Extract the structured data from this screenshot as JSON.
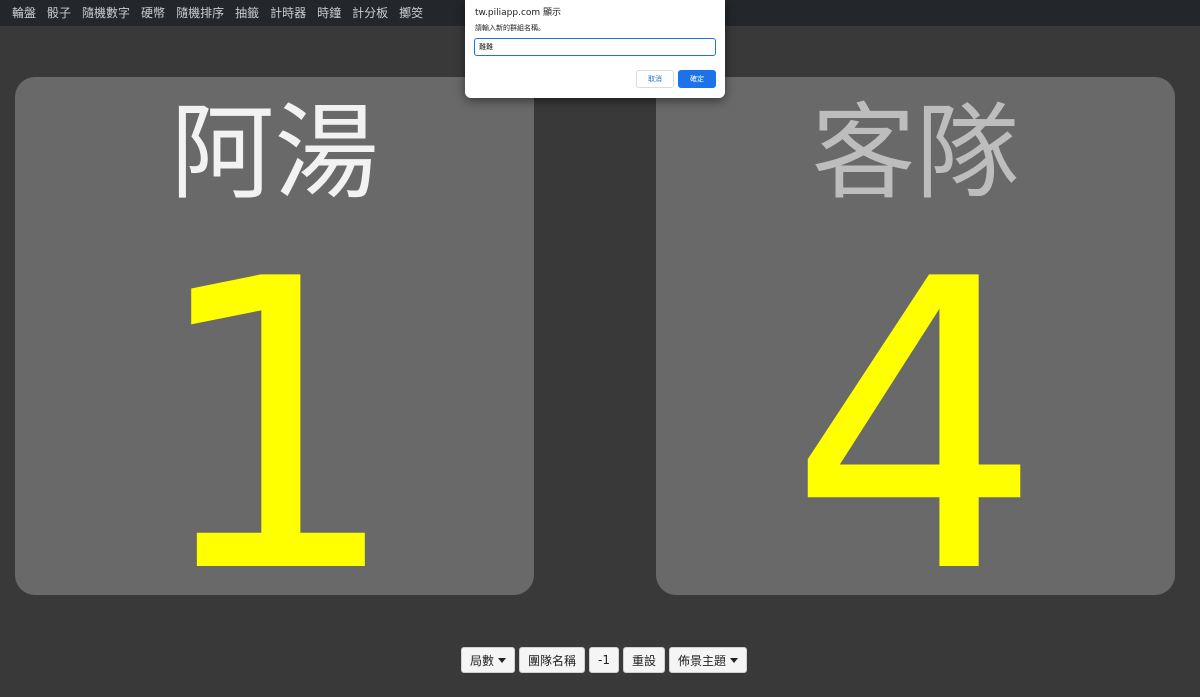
{
  "nav": {
    "items": [
      "輪盤",
      "骰子",
      "隨機數字",
      "硬幣",
      "隨機排序",
      "抽籤",
      "計時器",
      "時鐘",
      "計分板",
      "擲筊"
    ]
  },
  "scoreboard": {
    "left": {
      "team_name": "阿湯",
      "score": "1"
    },
    "right": {
      "team_name": "客隊",
      "score": "4"
    }
  },
  "controls": {
    "rounds_label": "局數",
    "team_names_label": "團隊名稱",
    "minus_label": "-1",
    "reset_label": "重設",
    "theme_label": "佈景主題"
  },
  "dialog": {
    "title": "tw.piliapp.com 顯示",
    "message": "請輸入新的群組名稱。",
    "input_value": "難難",
    "cancel_label": "取消",
    "ok_label": "確定"
  },
  "colors": {
    "background": "#393939",
    "panel": "#696969",
    "score": "#ffff00",
    "nav_bg": "#23262a",
    "accent": "#1a73e8"
  }
}
